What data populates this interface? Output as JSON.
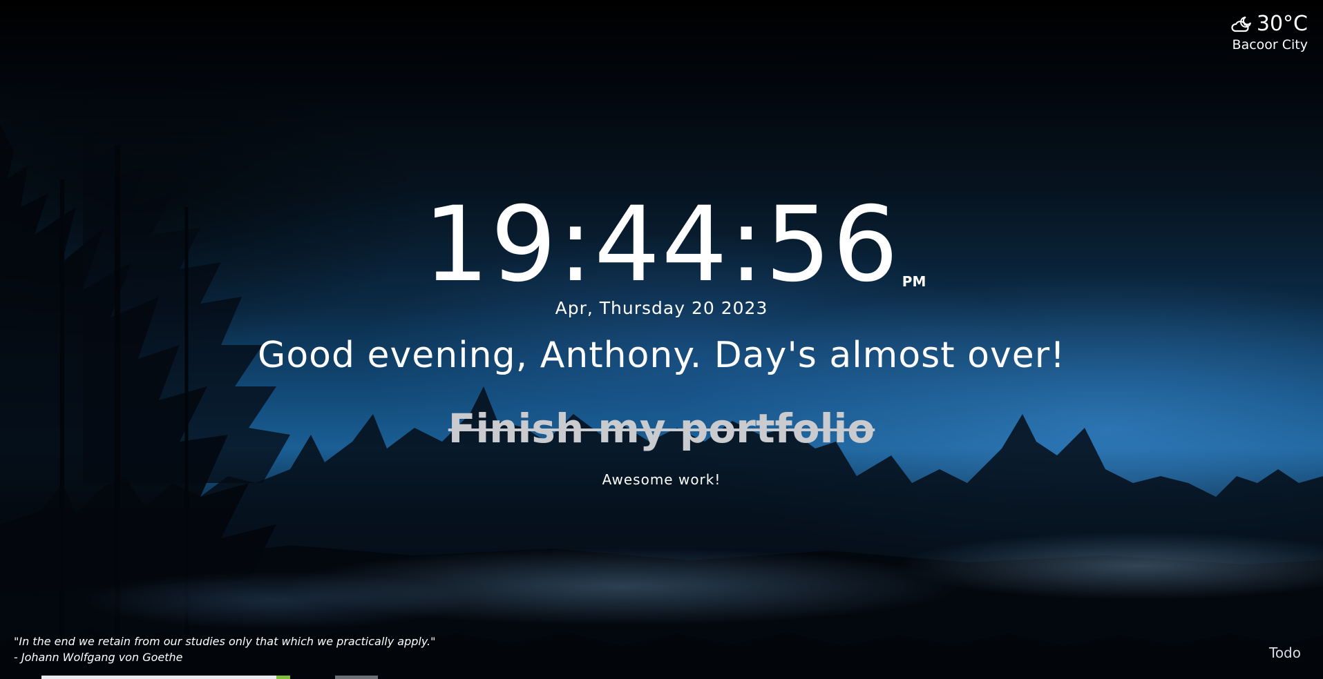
{
  "weather": {
    "icon": "partly-cloudy-night-icon",
    "temperature": "30°C",
    "city": "Bacoor City"
  },
  "clock": {
    "time": "19:44:56",
    "period": "PM"
  },
  "date": "Apr, Thursday 20 2023",
  "greeting": "Good evening, Anthony. Day's almost over!",
  "focus": {
    "task": "Finish my portfolio",
    "completed": true
  },
  "praise": "Awesome work!",
  "quote": {
    "text": "\"In the end we retain from our studies only that which we practically apply.\"",
    "author": "- Johann Wolfgang von Goethe"
  },
  "todo_label": "Todo",
  "colors": {
    "text": "#ffffff",
    "completed_task": "#c9cbcf",
    "sky_accent": "#1b5f95"
  }
}
